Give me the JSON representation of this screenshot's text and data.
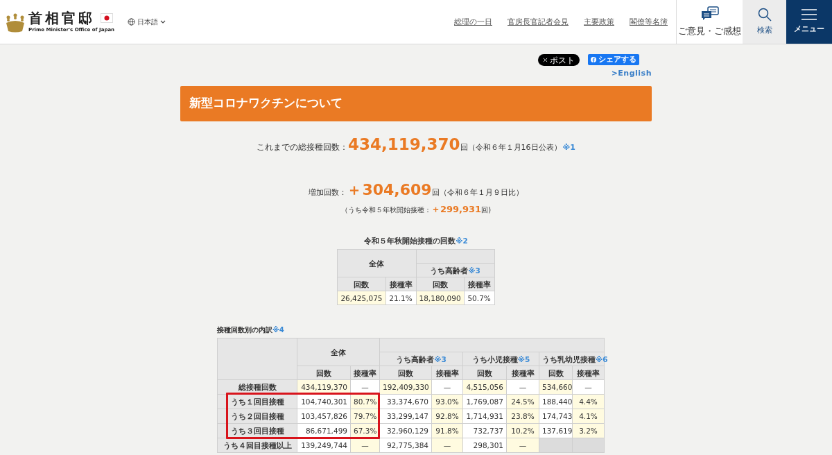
{
  "header": {
    "site_title": "首相官邸",
    "site_subtitle": "Prime Minister's Office of Japan",
    "language": "日本語",
    "nav_links": [
      "総理の一日",
      "官房長官記者会見",
      "主要政策",
      "閣僚等名簿"
    ],
    "actions": [
      {
        "kind": "feedback",
        "label": "ご意見・ご感想"
      },
      {
        "kind": "search",
        "label": "検索"
      },
      {
        "kind": "menu",
        "label": "メニュー"
      }
    ]
  },
  "share": {
    "x_button": "ポスト",
    "fb_button": "シェアする",
    "english_link": ">English"
  },
  "banner": "新型コロナワクチンについて",
  "total": {
    "label": "これまでの総接種回数：",
    "value": "434,119,370",
    "unit": "回",
    "date": "（令和６年１月16日公表）",
    "note": "※1"
  },
  "increase": {
    "label": "増加回数：",
    "value": "＋304,609",
    "unit": "回",
    "date": "（令和６年１月９日比）",
    "sub_open": "（うち令和５年秋開始接種：",
    "sub_value": "＋299,931",
    "sub_close": "回)"
  },
  "autumn_table": {
    "title": "令和５年秋開始接種の回数",
    "note": "※2",
    "group_all": "全体",
    "group_elderly": "うち高齢者",
    "group_elderly_note": "※3",
    "columns": [
      "回数",
      "接種率",
      "回数",
      "接種率"
    ],
    "cells": [
      {
        "text": "26,425,075",
        "highlighted": true
      },
      {
        "text": "21.1%",
        "highlighted": false
      },
      {
        "text": "18,180,090",
        "highlighted": true
      },
      {
        "text": "50.7%",
        "highlighted": false
      }
    ]
  },
  "breakdown_table": {
    "title": "接種回数別の内訳",
    "note": "※4",
    "group_all": "全体",
    "groups": [
      {
        "label": "うち高齢者",
        "note": "※3"
      },
      {
        "label": "うち小児接種",
        "note": "※5"
      },
      {
        "label": "うち乳幼児接種",
        "note": "※6"
      }
    ],
    "columns": [
      "回数",
      "接種率",
      "回数",
      "接種率",
      "回数",
      "接種率",
      "回数",
      "接種率"
    ],
    "rows": [
      {
        "label": "総接種回数",
        "framed": false,
        "cells": [
          {
            "text": "434,119,370",
            "highlighted": true
          },
          {
            "text": "—",
            "highlighted": false
          },
          {
            "text": "192,409,330",
            "highlighted": true
          },
          {
            "text": "—",
            "highlighted": false
          },
          {
            "text": "4,515,056",
            "highlighted": true
          },
          {
            "text": "—",
            "highlighted": false
          },
          {
            "text": "534,660",
            "highlighted": true
          },
          {
            "text": "—",
            "highlighted": false
          }
        ]
      },
      {
        "label": "うち１回目接種",
        "framed": true,
        "cells": [
          {
            "text": "104,740,301",
            "highlighted": false
          },
          {
            "text": "80.7%",
            "highlighted": true
          },
          {
            "text": "33,374,670",
            "highlighted": false
          },
          {
            "text": "93.0%",
            "highlighted": true
          },
          {
            "text": "1,769,087",
            "highlighted": false
          },
          {
            "text": "24.5%",
            "highlighted": true
          },
          {
            "text": "188,440",
            "highlighted": false
          },
          {
            "text": "4.4%",
            "highlighted": true
          }
        ]
      },
      {
        "label": "うち２回目接種",
        "framed": true,
        "cells": [
          {
            "text": "103,457,826",
            "highlighted": false
          },
          {
            "text": "79.7%",
            "highlighted": true
          },
          {
            "text": "33,299,147",
            "highlighted": false
          },
          {
            "text": "92.8%",
            "highlighted": true
          },
          {
            "text": "1,714,931",
            "highlighted": false
          },
          {
            "text": "23.8%",
            "highlighted": true
          },
          {
            "text": "174,743",
            "highlighted": false
          },
          {
            "text": "4.1%",
            "highlighted": true
          }
        ]
      },
      {
        "label": "うち３回目接種",
        "framed": true,
        "cells": [
          {
            "text": "86,671,499",
            "highlighted": false
          },
          {
            "text": "67.3%",
            "highlighted": true
          },
          {
            "text": "32,960,129",
            "highlighted": false
          },
          {
            "text": "91.8%",
            "highlighted": true
          },
          {
            "text": "732,737",
            "highlighted": false
          },
          {
            "text": "10.2%",
            "highlighted": true
          },
          {
            "text": "137,619",
            "highlighted": false
          },
          {
            "text": "3.2%",
            "highlighted": true
          }
        ]
      },
      {
        "label": "うち４回目接種以上",
        "framed": false,
        "cells": [
          {
            "text": "139,249,744",
            "highlighted": false
          },
          {
            "text": "—",
            "highlighted": true
          },
          {
            "text": "92,775,384",
            "highlighted": false
          },
          {
            "text": "—",
            "highlighted": true
          },
          {
            "text": "298,301",
            "highlighted": false
          },
          {
            "text": "—",
            "highlighted": true
          },
          {
            "kind": "empty"
          },
          {
            "kind": "empty"
          }
        ]
      }
    ]
  }
}
